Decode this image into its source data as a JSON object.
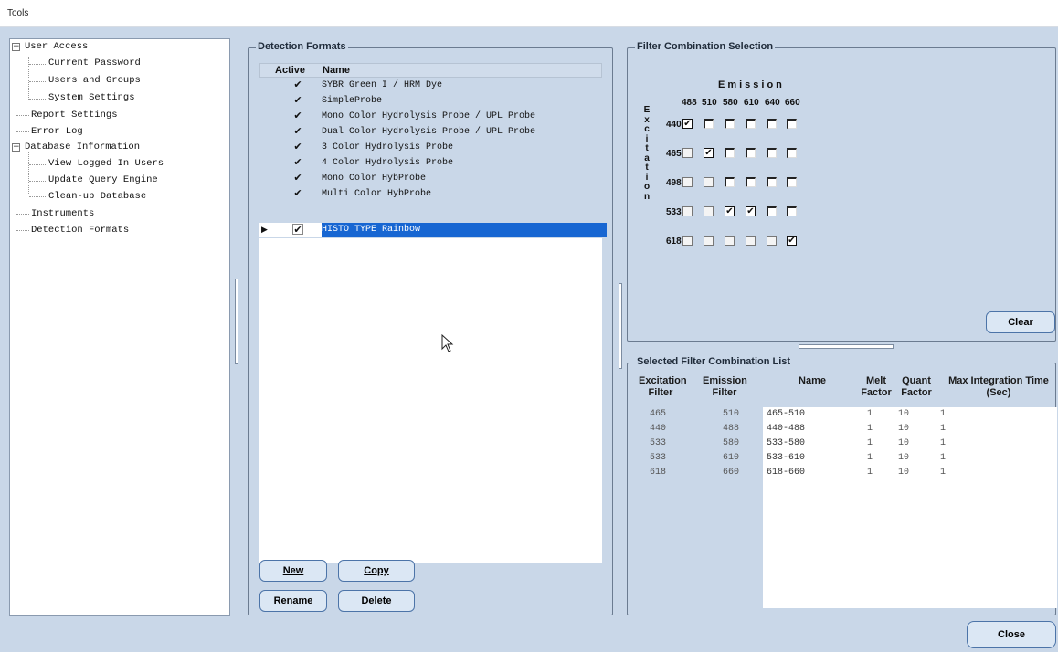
{
  "menu": {
    "tools": "Tools"
  },
  "tree": {
    "items": [
      {
        "label": "User Access",
        "level": 0,
        "expander": "minus"
      },
      {
        "label": "Current Password",
        "level": 1
      },
      {
        "label": "Users and Groups",
        "level": 1
      },
      {
        "label": "System Settings",
        "level": 1
      },
      {
        "label": "Report Settings",
        "level": 0
      },
      {
        "label": "Error Log",
        "level": 0
      },
      {
        "label": "Database Information",
        "level": 0,
        "expander": "minus"
      },
      {
        "label": "View Logged In Users",
        "level": 1
      },
      {
        "label": "Update Query Engine",
        "level": 1
      },
      {
        "label": "Clean-up Database",
        "level": 1
      },
      {
        "label": "Instruments",
        "level": 0
      },
      {
        "label": "Detection Formats",
        "level": 0
      }
    ]
  },
  "detection_formats": {
    "title": "Detection Formats",
    "col_active": "Active",
    "col_name": "Name",
    "rows": [
      {
        "active": true,
        "name": "SYBR Green I / HRM Dye"
      },
      {
        "active": true,
        "name": "SimpleProbe"
      },
      {
        "active": true,
        "name": "Mono Color Hydrolysis Probe / UPL Probe"
      },
      {
        "active": true,
        "name": "Dual Color Hydrolysis Probe / UPL Probe"
      },
      {
        "active": true,
        "name": "3 Color Hydrolysis Probe"
      },
      {
        "active": true,
        "name": "4 Color Hydrolysis Probe"
      },
      {
        "active": true,
        "name": "Mono Color HybProbe"
      },
      {
        "active": true,
        "name": "Multi Color HybProbe"
      },
      {
        "active": true,
        "name": "HISTO TYPE Rainbow",
        "selected": true
      }
    ],
    "buttons": {
      "new": "New",
      "copy": "Copy",
      "rename": "Rename",
      "delete": "Delete"
    }
  },
  "filter_selection": {
    "title": "Filter Combination Selection",
    "emission_label": "Emission",
    "excitation_letters": [
      "E",
      "x",
      "c",
      "i",
      "t",
      "a",
      "t",
      "i",
      "o",
      "n"
    ],
    "emission": [
      "488",
      "510",
      "580",
      "610",
      "640",
      "660"
    ],
    "excitation": [
      "440",
      "465",
      "498",
      "533",
      "618"
    ],
    "grid": [
      [
        "on",
        "off",
        "off",
        "off",
        "off",
        "off"
      ],
      [
        "dis",
        "on",
        "off",
        "off",
        "off",
        "off"
      ],
      [
        "dis",
        "dis",
        "off",
        "off",
        "off",
        "off"
      ],
      [
        "dis",
        "dis",
        "on",
        "on",
        "off",
        "off"
      ],
      [
        "dis",
        "dis",
        "dis",
        "dis",
        "dis",
        "on"
      ]
    ],
    "clear_button": "Clear"
  },
  "selected_list": {
    "title": "Selected Filter Combination List",
    "headers": {
      "excitation": "Excitation Filter",
      "emission": "Emission Filter",
      "name": "Name",
      "melt": "Melt Factor",
      "quant": "Quant Factor",
      "max": "Max Integration Time (Sec)"
    },
    "rows": [
      {
        "excitation": "465",
        "emission": "510",
        "name": "465-510",
        "melt": "1",
        "quant": "10",
        "max": "1"
      },
      {
        "excitation": "440",
        "emission": "488",
        "name": "440-488",
        "melt": "1",
        "quant": "10",
        "max": "1"
      },
      {
        "excitation": "533",
        "emission": "580",
        "name": "533-580",
        "melt": "1",
        "quant": "10",
        "max": "1"
      },
      {
        "excitation": "533",
        "emission": "610",
        "name": "533-610",
        "melt": "1",
        "quant": "10",
        "max": "1"
      },
      {
        "excitation": "618",
        "emission": "660",
        "name": "618-660",
        "melt": "1",
        "quant": "10",
        "max": "1"
      }
    ]
  },
  "footer": {
    "close_button": "Close"
  }
}
